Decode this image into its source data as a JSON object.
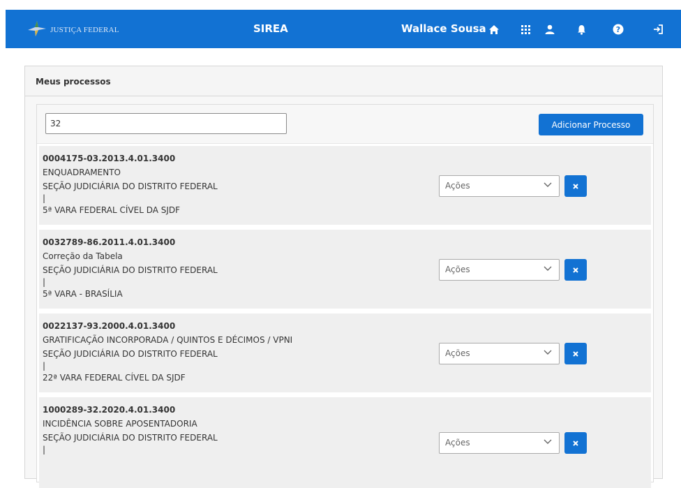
{
  "header": {
    "brand": "JUSTIÇA FEDERAL",
    "app_name": "SIREA",
    "user_name": "Wallace Sousa",
    "icons": [
      "home-icon",
      "apps-grid-icon",
      "user-icon",
      "bell-icon",
      "help-icon",
      "logout-icon"
    ]
  },
  "panel": {
    "title": "Meus processos"
  },
  "search": {
    "value": "32"
  },
  "add_button_label": "Adicionar Processo",
  "processes": [
    {
      "number": "0004175-03.2013.4.01.3400",
      "subject": "ENQUADRAMENTO",
      "section": "SEÇÃO JUDICIÁRIA DO DISTRITO FEDERAL",
      "separator": "|",
      "court": "5ª VARA FEDERAL CÍVEL DA SJDF",
      "actions_label": "Ações"
    },
    {
      "number": "0032789-86.2011.4.01.3400",
      "subject": "Correção da Tabela",
      "section": "SEÇÃO JUDICIÁRIA DO DISTRITO FEDERAL",
      "separator": "|",
      "court": "5ª VARA - BRASÍLIA",
      "actions_label": "Ações"
    },
    {
      "number": "0022137-93.2000.4.01.3400",
      "subject": "GRATIFICAÇÃO INCORPORADA / QUINTOS E DÉCIMOS / VPNI",
      "section": "SEÇÃO JUDICIÁRIA DO DISTRITO FEDERAL",
      "separator": "|",
      "court": "22ª VARA FEDERAL CÍVEL DA SJDF",
      "actions_label": "Ações"
    },
    {
      "number": "1000289-32.2020.4.01.3400",
      "subject": "INCIDÊNCIA SOBRE APOSENTADORIA",
      "section": "SEÇÃO JUDICIÁRIA DO DISTRITO FEDERAL",
      "separator": "|",
      "court": "",
      "actions_label": "Ações"
    }
  ],
  "colors": {
    "primary": "#1272d3",
    "row_bg": "#efefef"
  }
}
